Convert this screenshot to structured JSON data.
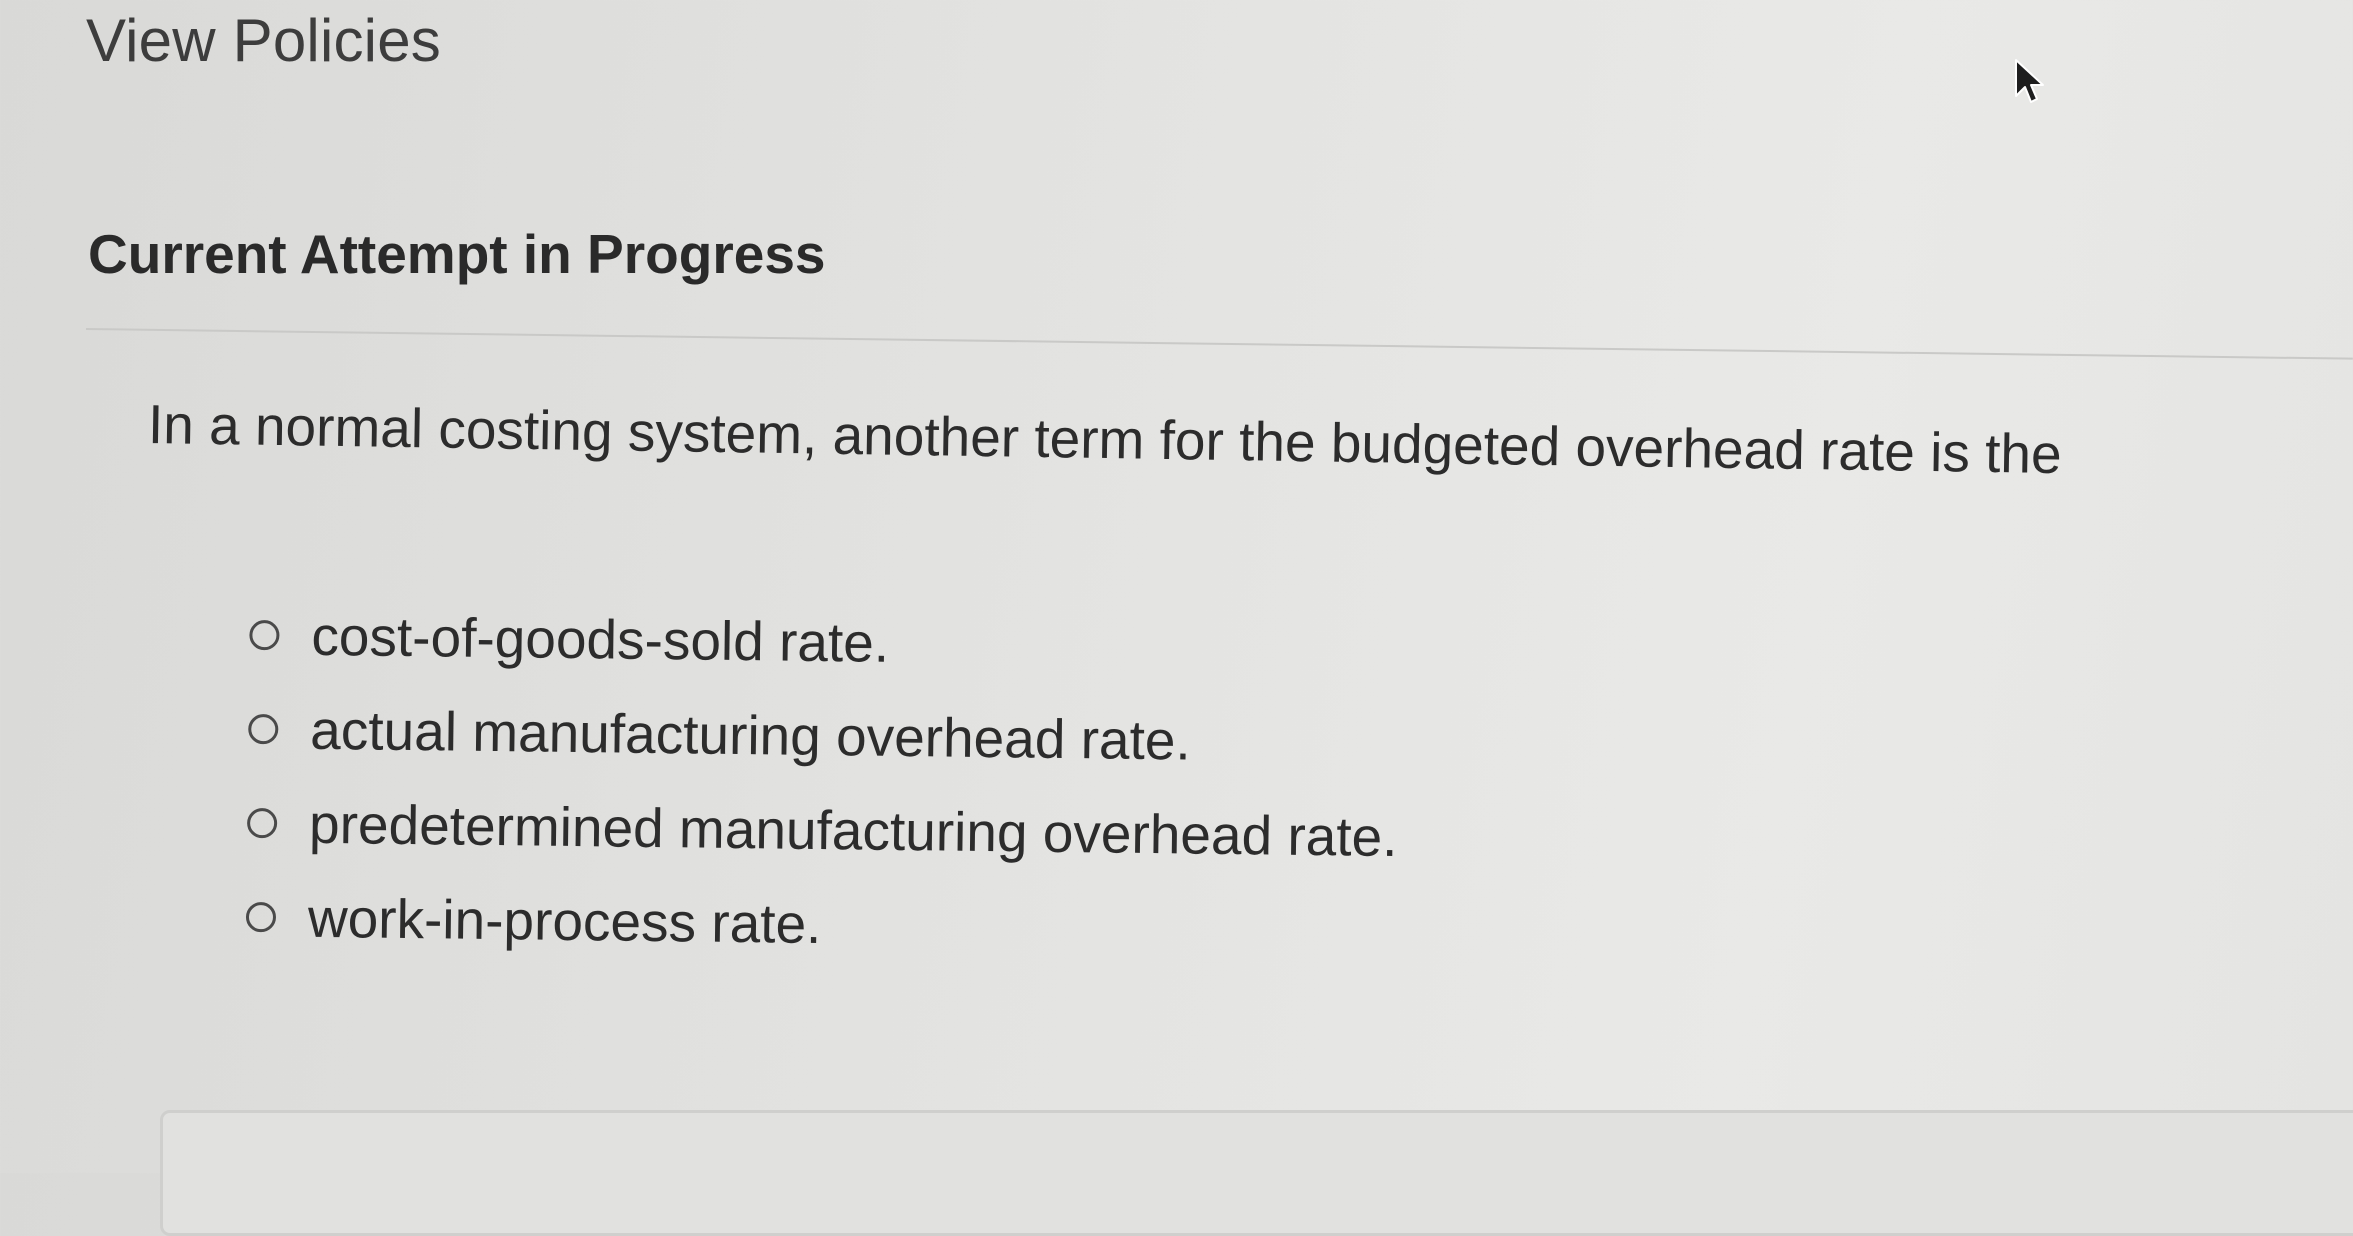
{
  "header": {
    "link_label": "View Policies"
  },
  "section": {
    "title": "Current Attempt in Progress"
  },
  "question": {
    "text": "In a normal costing system, another term for the budgeted overhead rate is the",
    "options": [
      {
        "label": "cost-of-goods-sold rate.",
        "selected": false
      },
      {
        "label": "actual manufacturing overhead rate.",
        "selected": false
      },
      {
        "label": "predetermined manufacturing overhead rate.",
        "selected": false
      },
      {
        "label": "work-in-process rate.",
        "selected": false
      }
    ]
  },
  "icons": {
    "cursor": "mouse-pointer-icon",
    "radio": "radio-button-icon"
  },
  "colors": {
    "background": "#e3e3e1",
    "text": "#2c2c2c",
    "divider": "#c9c9c7"
  }
}
